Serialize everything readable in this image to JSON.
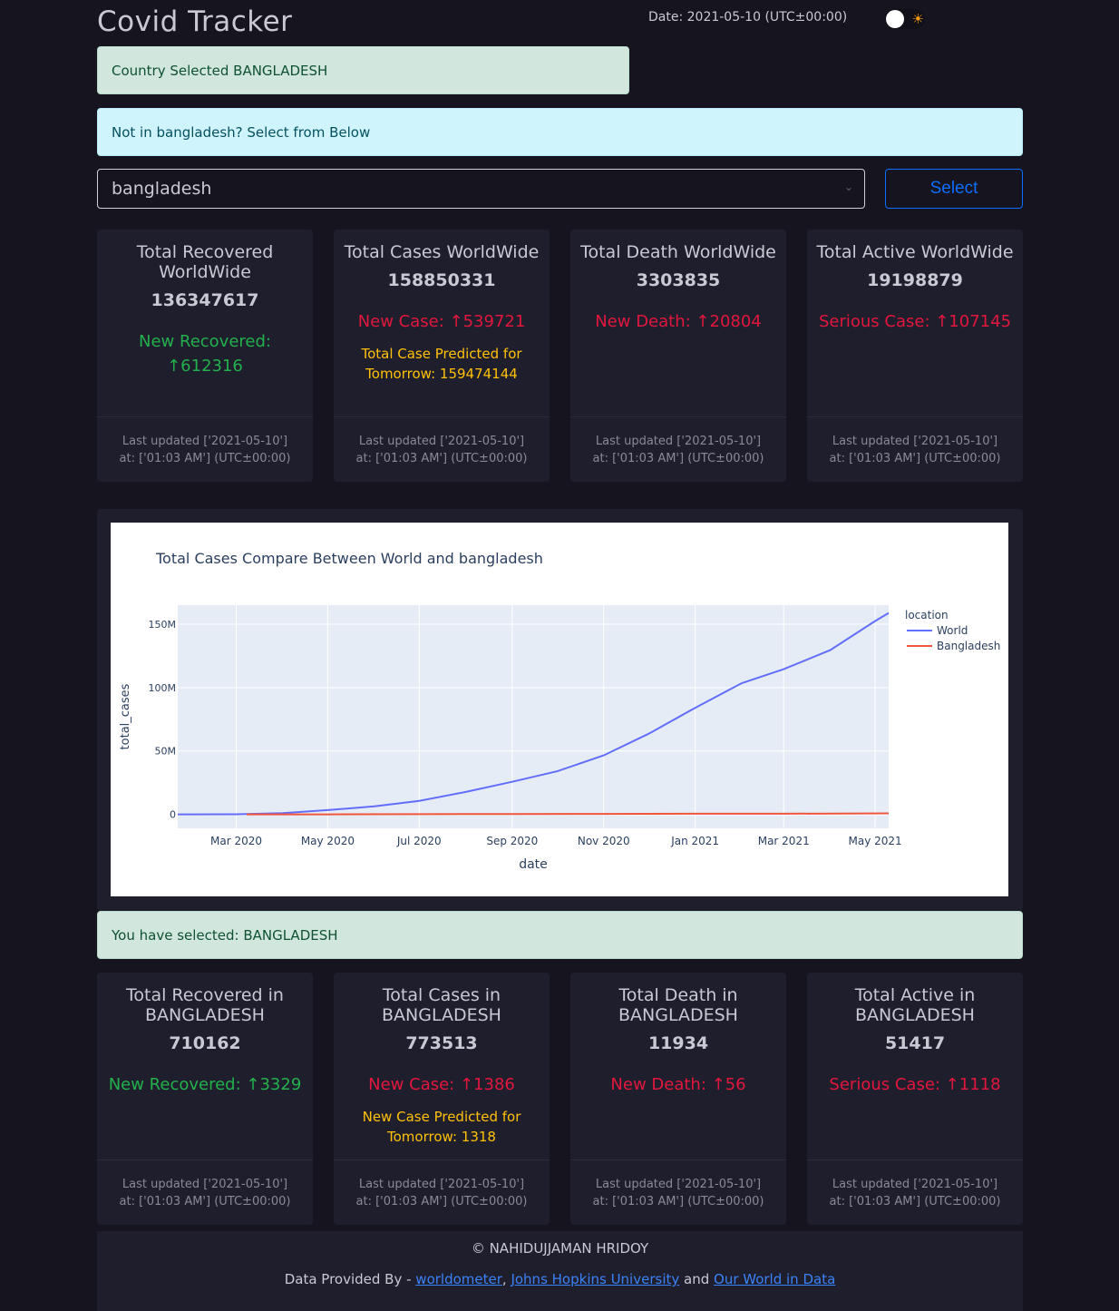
{
  "header": {
    "title": "Covid Tracker",
    "date": "Date: 2021-05-10 (UTC±00:00)",
    "theme_icon": "sun-icon"
  },
  "alerts": {
    "country_selected": "Country Selected BANGLADESH",
    "not_in": "Not in bangladesh? Select from Below",
    "you_selected": "You have selected: BANGLADESH"
  },
  "country_select": {
    "value": "bangladesh",
    "button_label": "Select"
  },
  "world_cards": [
    {
      "title": "Total Recovered WorldWide",
      "value": "136347617",
      "delta": "New Recovered: ↑612316",
      "delta_color": "green",
      "prediction": "",
      "footer": "Last updated ['2021-05-10'] at: ['01:03 AM'] (UTC±00:00)"
    },
    {
      "title": "Total Cases WorldWide",
      "value": "158850331",
      "delta": "New Case: ↑539721",
      "delta_color": "red",
      "prediction": "Total Case Predicted for Tomorrow: 159474144",
      "footer": "Last updated ['2021-05-10'] at: ['01:03 AM'] (UTC±00:00)"
    },
    {
      "title": "Total Death WorldWide",
      "value": "3303835",
      "delta": "New Death: ↑20804",
      "delta_color": "red",
      "prediction": "",
      "footer": "Last updated ['2021-05-10'] at: ['01:03 AM'] (UTC±00:00)"
    },
    {
      "title": "Total Active WorldWide",
      "value": "19198879",
      "delta": "Serious Case: ↑107145",
      "delta_color": "red",
      "prediction": "",
      "footer": "Last updated ['2021-05-10'] at: ['01:03 AM'] (UTC±00:00)"
    }
  ],
  "country_cards": [
    {
      "title": "Total Recovered in BANGLADESH",
      "value": "710162",
      "delta": "New Recovered: ↑3329",
      "delta_color": "green",
      "prediction": "",
      "footer": "Last updated ['2021-05-10'] at: ['01:03 AM'] (UTC±00:00)"
    },
    {
      "title": "Total Cases in BANGLADESH",
      "value": "773513",
      "delta": "New Case: ↑1386",
      "delta_color": "red",
      "prediction": "New Case Predicted for Tomorrow: 1318",
      "footer": "Last updated ['2021-05-10'] at: ['01:03 AM'] (UTC±00:00)"
    },
    {
      "title": "Total Death in BANGLADESH",
      "value": "11934",
      "delta": "New Death: ↑56",
      "delta_color": "red",
      "prediction": "",
      "footer": "Last updated ['2021-05-10'] at: ['01:03 AM'] (UTC±00:00)"
    },
    {
      "title": "Total Active in BANGLADESH",
      "value": "51417",
      "delta": "Serious Case: ↑1118",
      "delta_color": "red",
      "prediction": "",
      "footer": "Last updated ['2021-05-10'] at: ['01:03 AM'] (UTC±00:00)"
    }
  ],
  "colors": {
    "green": "#22b14c",
    "red": "#e2173d",
    "prediction": "#ffc107",
    "world_line": "#636efa",
    "bangladesh_line": "#ef553b"
  },
  "chart_data": {
    "type": "line",
    "title": "Total Cases Compare Between World and bangladesh",
    "xlabel": "date",
    "ylabel": "total_cases",
    "legend_title": "location",
    "legend_position": "right",
    "grid": true,
    "x_ticks": [
      "Mar 2020",
      "May 2020",
      "Jul 2020",
      "Sep 2020",
      "Nov 2020",
      "Jan 2021",
      "Mar 2021",
      "May 2021"
    ],
    "y_ticks": [
      "0",
      "50M",
      "100M",
      "150M"
    ],
    "y_tick_values": [
      0,
      50000000,
      100000000,
      150000000
    ],
    "xlim": [
      "2020-01-22",
      "2021-05-10"
    ],
    "ylim": [
      -11000000,
      165000000
    ],
    "series": [
      {
        "name": "World",
        "color": "#636efa",
        "x": [
          "2020-01-22",
          "2020-03-01",
          "2020-04-01",
          "2020-05-01",
          "2020-06-01",
          "2020-07-01",
          "2020-08-01",
          "2020-09-01",
          "2020-10-01",
          "2020-11-01",
          "2020-12-01",
          "2021-01-01",
          "2021-02-01",
          "2021-03-01",
          "2021-04-01",
          "2021-05-01",
          "2021-05-10"
        ],
        "y": [
          600,
          88000,
          950000,
          3400000,
          6300000,
          10700000,
          17700000,
          25700000,
          34000000,
          46500000,
          63600000,
          84000000,
          103500000,
          114500000,
          129500000,
          152500000,
          158850331
        ]
      },
      {
        "name": "Bangladesh",
        "color": "#ef553b",
        "x": [
          "2020-03-08",
          "2020-05-01",
          "2020-07-01",
          "2020-09-01",
          "2020-11-01",
          "2021-01-01",
          "2021-03-01",
          "2021-05-10"
        ],
        "y": [
          3,
          8790,
          149000,
          314000,
          410000,
          514000,
          551000,
          773513
        ]
      }
    ]
  },
  "footer": {
    "copyright": "© NAHIDUJJAMAN HRIDOY",
    "provided_prefix": "Data Provided By - ",
    "link1": "worldometer",
    "sep1": ", ",
    "link2": "Johns Hopkins University",
    "sep2": " and ",
    "link3": "Our World in Data"
  }
}
